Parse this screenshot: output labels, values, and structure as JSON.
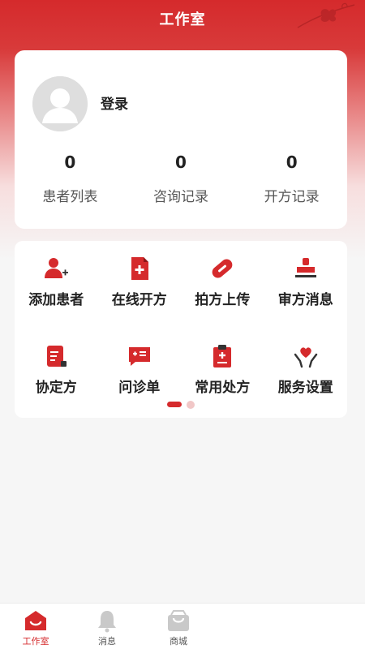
{
  "header": {
    "title": "工作室"
  },
  "profile": {
    "login_label": "登录",
    "stats": [
      {
        "value": "0",
        "label": "患者列表"
      },
      {
        "value": "0",
        "label": "咨询记录"
      },
      {
        "value": "0",
        "label": "开方记录"
      }
    ]
  },
  "menu": {
    "items": [
      {
        "label": "添加患者",
        "icon": "add-patient-icon"
      },
      {
        "label": "在线开方",
        "icon": "prescription-doc-icon"
      },
      {
        "label": "拍方上传",
        "icon": "pill-capsule-icon"
      },
      {
        "label": "审方消息",
        "icon": "stamp-icon"
      },
      {
        "label": "协定方",
        "icon": "agreement-doc-icon"
      },
      {
        "label": "问诊单",
        "icon": "chat-form-icon"
      },
      {
        "label": "常用处方",
        "icon": "clipboard-icon"
      },
      {
        "label": "服务设置",
        "icon": "heart-hands-icon"
      }
    ],
    "pager": {
      "current_page": 1,
      "total_pages": 2
    }
  },
  "tabbar": {
    "items": [
      {
        "label": "工作室",
        "active": true
      },
      {
        "label": "消息",
        "active": false
      },
      {
        "label": "商城",
        "active": false
      }
    ]
  },
  "colors": {
    "accent": "#d52a2c",
    "inactive_icon": "#c9c9c9",
    "text": "#222222"
  }
}
